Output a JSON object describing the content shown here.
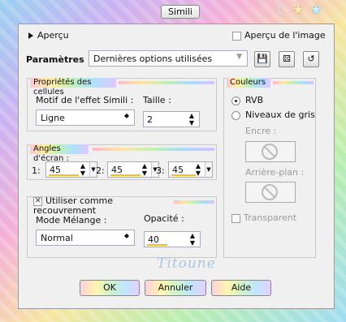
{
  "window": {
    "title": "Simili"
  },
  "top": {
    "apercu_label": "Aperçu",
    "apercu_image_label": "Aperçu de l'image"
  },
  "params": {
    "label": "Paramètres",
    "preset_value": "Dernières options utilisées",
    "tool_icons": [
      "save-icon",
      "randomize-icon",
      "reset-icon"
    ]
  },
  "cells": {
    "title": "Propriétés des cellules",
    "motif_label": "Motif de l'effet Simili :",
    "motif_value": "Ligne",
    "taille_label": "Taille :",
    "taille_value": "2"
  },
  "angles": {
    "title": "Angles d'écran :",
    "items": [
      {
        "label": "1:",
        "value": "45"
      },
      {
        "label": "2:",
        "value": "45"
      },
      {
        "label": "3:",
        "value": "45"
      }
    ]
  },
  "overlay": {
    "title": "Utiliser comme recouvrement",
    "mode_label": "Mode Mélange :",
    "mode_value": "Normal",
    "opacity_label": "Opacité :",
    "opacity_value": "40"
  },
  "colors": {
    "title": "Couleurs",
    "rvb_label": "RVB",
    "gris_label": "Niveaux de gris",
    "encre_label": "Encre :",
    "arriere_label": "Arrière-plan :",
    "transparent_label": "Transparent"
  },
  "buttons": {
    "ok": "OK",
    "cancel": "Annuler",
    "help": "Aide"
  },
  "watermark": "Titoune",
  "accent": {
    "spin_underline": "#f0c020",
    "frame_gradient": [
      "#9ad0f0",
      "#f4b0d8",
      "#f6e6a0",
      "#b8eeb0"
    ]
  }
}
